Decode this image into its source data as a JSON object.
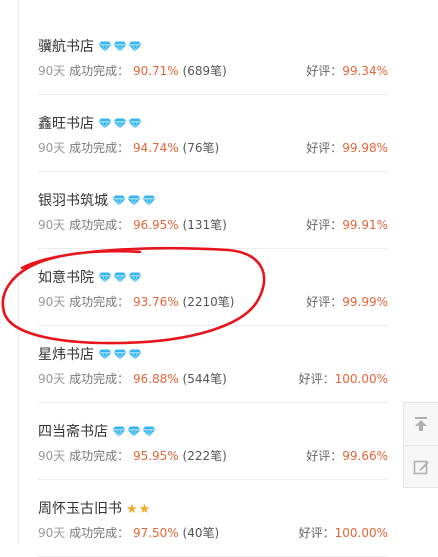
{
  "stores": [
    {
      "name": "骥航书店",
      "badge": "diamond",
      "badge_count": 3,
      "days": "90天",
      "success_label": "成功完成：",
      "success_rate": "90.71%",
      "orders": "(689笔)",
      "review_label": "好评：",
      "review_rate": "99.34%"
    },
    {
      "name": "鑫旺书店",
      "badge": "diamond",
      "badge_count": 3,
      "days": "90天",
      "success_label": "成功完成：",
      "success_rate": "94.74%",
      "orders": "(76笔)",
      "review_label": "好评：",
      "review_rate": "99.98%"
    },
    {
      "name": "银羽书筑城",
      "badge": "diamond",
      "badge_count": 3,
      "days": "90天",
      "success_label": "成功完成：",
      "success_rate": "96.95%",
      "orders": "(131笔)",
      "review_label": "好评：",
      "review_rate": "99.91%"
    },
    {
      "name": "如意书院",
      "badge": "diamond",
      "badge_count": 3,
      "days": "90天",
      "success_label": "成功完成：",
      "success_rate": "93.76%",
      "orders": "(2210笔)",
      "review_label": "好评：",
      "review_rate": "99.99%"
    },
    {
      "name": "星炜书店",
      "badge": "diamond",
      "badge_count": 3,
      "days": "90天",
      "success_label": "成功完成：",
      "success_rate": "96.88%",
      "orders": "(544笔)",
      "review_label": "好评：",
      "review_rate": "100.00%"
    },
    {
      "name": "四当斋书店",
      "badge": "diamond",
      "badge_count": 3,
      "days": "90天",
      "success_label": "成功完成：",
      "success_rate": "95.95%",
      "orders": "(222笔)",
      "review_label": "好评：",
      "review_rate": "99.66%"
    },
    {
      "name": "周怀玉古旧书",
      "badge": "star",
      "badge_count": 2,
      "days": "90天",
      "success_label": "成功完成：",
      "success_rate": "97.50%",
      "orders": "(40笔)",
      "review_label": "好评：",
      "review_rate": "100.00%"
    }
  ],
  "side_tools": [
    {
      "icon": "back-to-top-icon"
    },
    {
      "icon": "edit-feedback-icon"
    }
  ],
  "annotation": {
    "color": "#e8141b",
    "highlighted_store": "如意书院"
  },
  "colors": {
    "accent": "#e8653a",
    "diamond": "#35b6f0",
    "star": "#f5a623"
  }
}
